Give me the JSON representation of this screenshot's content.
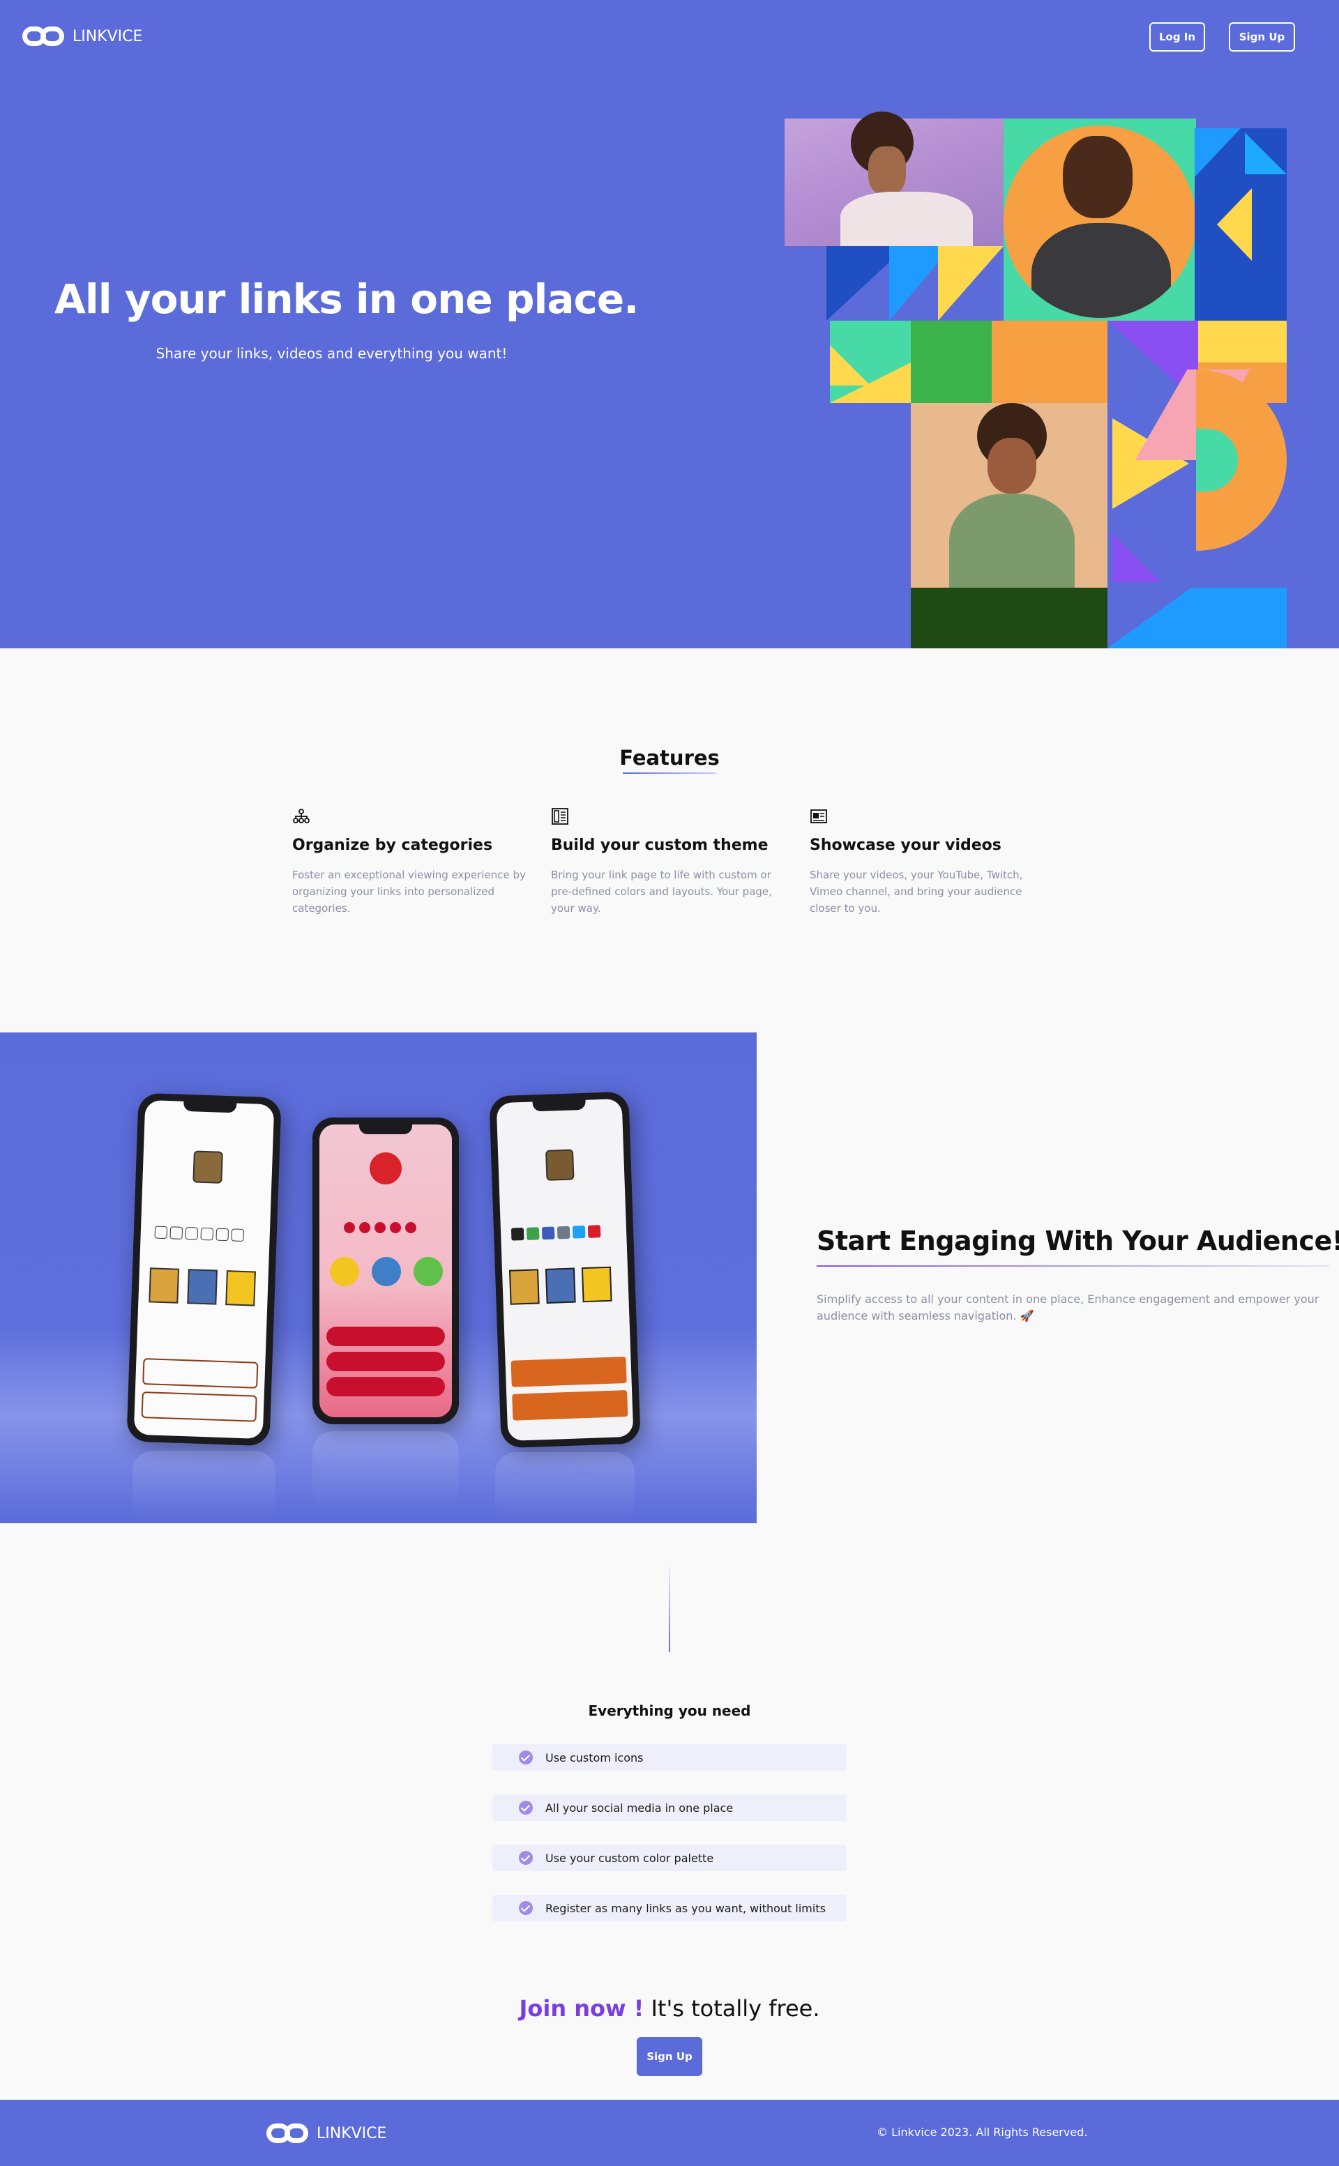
{
  "brand": {
    "name": "LINKVICE"
  },
  "nav": {
    "login_label": "Log In",
    "signup_label": "Sign Up"
  },
  "hero": {
    "title": "All your links in one place.",
    "subtitle": "Share your links, videos and everything you want!"
  },
  "features": {
    "title": "Features",
    "items": [
      {
        "icon": "sitemap-icon",
        "title": "Organize by categories",
        "text": "Foster an exceptional viewing experience by organizing your links into personalized categories."
      },
      {
        "icon": "newspaper-icon",
        "title": "Build your custom theme",
        "text": "Bring your link page to life with custom or pre-defined colors and layouts. Your page, your way."
      },
      {
        "icon": "video-card-icon",
        "title": "Showcase your videos",
        "text": "Share your videos, your YouTube, Twitch, Vimeo channel, and bring your audience closer to you."
      }
    ]
  },
  "engage": {
    "title": "Start Engaging With Your Audience!",
    "text": "Simplify access to all your content in one place, Enhance engagement and empower your audience with seamless navigation. 🚀"
  },
  "need": {
    "title": "Everything you need",
    "items": [
      "Use custom icons",
      "All your social media in one place",
      "Use your custom color palette",
      "Register as many links as you want, without limits"
    ]
  },
  "join": {
    "accent": "Join now !",
    "rest": "It's totally free.",
    "button_label": "Sign Up"
  },
  "footer": {
    "copyright": "© Linkvice 2023. All Rights Reserved."
  },
  "colors": {
    "brand": "#5b6bd9",
    "accent": "#7a3ee0",
    "muted_text": "#8a8fa3"
  }
}
